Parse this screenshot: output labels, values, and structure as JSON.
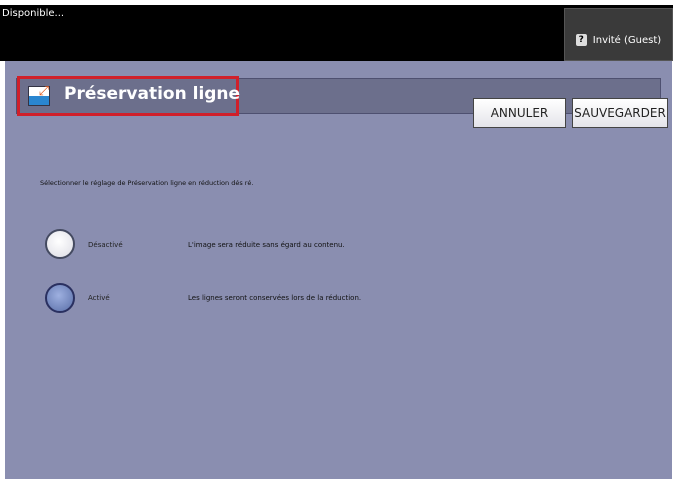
{
  "status": "Disponible...",
  "guest": "Invité (Guest)",
  "header": {
    "title": "Préservation ligne",
    "cancel": "ANNULER",
    "save": "SAUVEGARDER"
  },
  "prompt": "Sélectionner le réglage de Préservation ligne en réduction dés ré.",
  "options": [
    {
      "label": "Désactivé",
      "description": "L'image sera réduite sans égard au contenu.",
      "selected": false
    },
    {
      "label": "Activé",
      "description": "Les lignes seront conservées lors de la réduction.",
      "selected": true
    }
  ]
}
